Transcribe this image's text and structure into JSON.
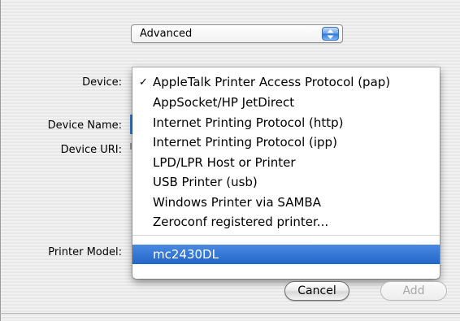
{
  "mode_popup": {
    "selected": "Advanced"
  },
  "form": {
    "device_label": "Device:",
    "device_name_label": "Device Name:",
    "device_uri_label": "Device URI:",
    "printer_model_label": "Printer Model:"
  },
  "device_menu": {
    "checked_index": 0,
    "highlighted_index": 8,
    "items": [
      "AppleTalk Printer Access Protocol (pap)",
      "AppSocket/HP JetDirect",
      "Internet Printing Protocol (http)",
      "Internet Printing Protocol (ipp)",
      "LPD/LPR Host or Printer",
      "USB Printer (usb)",
      "Windows Printer via SAMBA",
      "Zeroconf registered printer...",
      "mc2430DL"
    ],
    "check_glyph": "✓"
  },
  "buttons": {
    "cancel": "Cancel",
    "add": "Add"
  },
  "colors": {
    "selection": "#2a6fd0",
    "popup_arrow_accent": "#2e74d7"
  }
}
